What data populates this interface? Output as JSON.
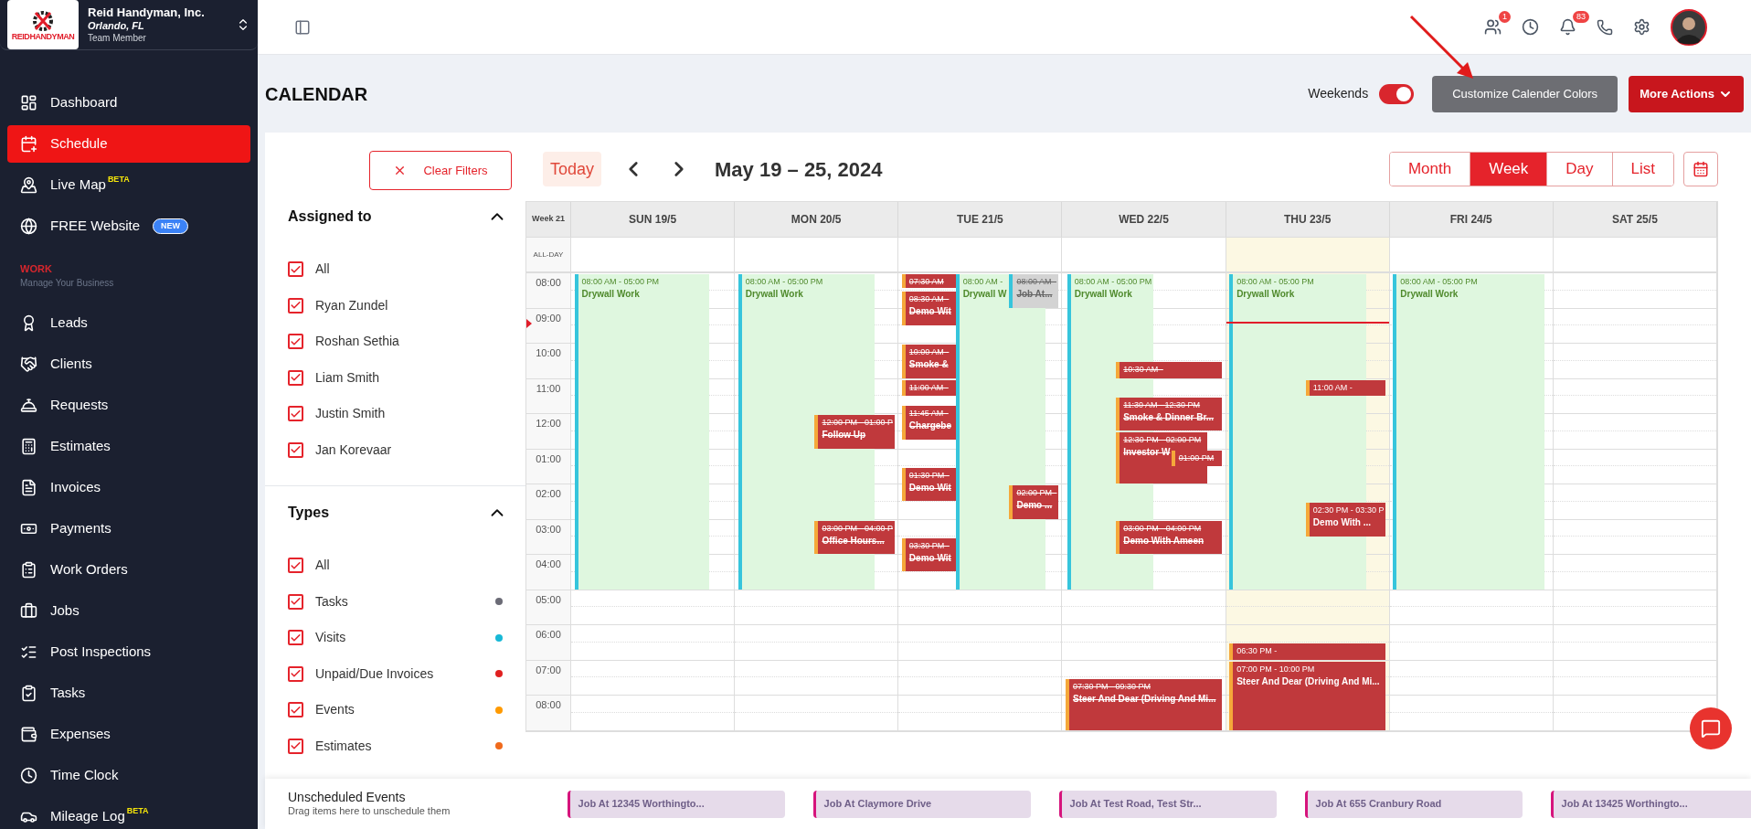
{
  "sidebar": {
    "account": {
      "logo_text": "REIDHANDYMAN",
      "name": "Reid Handyman, Inc.",
      "location": "Orlando, FL",
      "role": "Team Member"
    },
    "items": [
      {
        "kind": "link",
        "label": "Dashboard",
        "selected": false
      },
      {
        "kind": "link",
        "label": "Schedule",
        "selected": true
      },
      {
        "kind": "link",
        "label": "Live Map",
        "selected": false,
        "sup_label": "BETA"
      },
      {
        "kind": "link",
        "label": "FREE Website",
        "selected": false,
        "tag": "NEW"
      },
      {
        "kind": "section",
        "title": "WORK",
        "subtitle": "Manage Your Business"
      },
      {
        "kind": "link",
        "label": "Leads",
        "selected": false
      },
      {
        "kind": "link",
        "label": "Clients",
        "selected": false
      },
      {
        "kind": "link",
        "label": "Requests",
        "selected": false
      },
      {
        "kind": "link",
        "label": "Estimates",
        "selected": false
      },
      {
        "kind": "link",
        "label": "Invoices",
        "selected": false
      },
      {
        "kind": "link",
        "label": "Payments",
        "selected": false
      },
      {
        "kind": "link",
        "label": "Work Orders",
        "selected": false
      },
      {
        "kind": "link",
        "label": "Jobs",
        "selected": false
      },
      {
        "kind": "link",
        "label": "Post Inspections",
        "selected": false
      },
      {
        "kind": "link",
        "label": "Tasks",
        "selected": false
      },
      {
        "kind": "link",
        "label": "Expenses",
        "selected": false
      },
      {
        "kind": "link",
        "label": "Time Clock",
        "selected": false
      },
      {
        "kind": "link",
        "label": "Mileage Log",
        "selected": false,
        "sup_label": "BETA"
      }
    ]
  },
  "topbar": {
    "team_badge": "1",
    "notification_badge": "83"
  },
  "page": {
    "title": "CALENDAR",
    "weekends": {
      "label": "Weekends",
      "on": true
    },
    "buttons": [
      {
        "label": "Customize Calender Colors",
        "kind": "secondary"
      },
      {
        "label": "More Actions",
        "kind": "menu"
      }
    ]
  },
  "filters": {
    "clear_label": "Clear Filters",
    "groups": [
      {
        "title": "Assigned to",
        "expanded": true,
        "options": [
          {
            "label": "All",
            "checked": true
          },
          {
            "label": "Ryan Zundel",
            "checked": true
          },
          {
            "label": "Roshan Sethia",
            "checked": true
          },
          {
            "label": "Liam Smith",
            "checked": true
          },
          {
            "label": "Justin Smith",
            "checked": true
          },
          {
            "label": "Jan Korevaar",
            "checked": true
          }
        ]
      },
      {
        "title": "Types",
        "expanded": true,
        "options": [
          {
            "label": "All",
            "checked": true
          },
          {
            "label": "Tasks",
            "checked": true,
            "color": "#6b6b76"
          },
          {
            "label": "Visits",
            "checked": true,
            "color": "#17b8d6"
          },
          {
            "label": "Unpaid/Due Invoices",
            "checked": true,
            "color": "#e02020"
          },
          {
            "label": "Events",
            "checked": true,
            "color": "#ff9a00"
          },
          {
            "label": "Estimates",
            "checked": true,
            "color": "#f06a1c"
          }
        ]
      }
    ]
  },
  "calendar": {
    "today_label": "Today",
    "range": "May 19 – 25, 2024",
    "views": [
      {
        "label": "Month",
        "selected": false
      },
      {
        "label": "Week",
        "selected": true
      },
      {
        "label": "Day",
        "selected": false
      },
      {
        "label": "List",
        "selected": false
      }
    ],
    "week_label": "Week 21",
    "allday_label": "ALL-DAY",
    "days": [
      {
        "label": "SUN 19/5",
        "today": false
      },
      {
        "label": "MON 20/5",
        "today": false
      },
      {
        "label": "TUE 21/5",
        "today": false
      },
      {
        "label": "WED 22/5",
        "today": false
      },
      {
        "label": "THU 23/5",
        "today": true
      },
      {
        "label": "FRI 24/5",
        "today": false
      },
      {
        "label": "SAT 25/5",
        "today": false
      }
    ],
    "hours": [
      "08:00",
      "09:00",
      "10:00",
      "11:00",
      "12:00",
      "01:00",
      "02:00",
      "03:00",
      "04:00",
      "05:00",
      "06:00",
      "07:00",
      "08:00"
    ],
    "events": [
      {
        "kind": "work",
        "time": "08:00 AM - 05:00 PM",
        "title": "Drywall Work",
        "struck": false
      },
      {
        "kind": "work",
        "time": "08:00 AM - 05:00 PM",
        "title": "Drywall Work",
        "struck": false
      },
      {
        "kind": "event",
        "time": "12:00 PM - 01:00 P",
        "title": "Follow Up",
        "struck": true
      },
      {
        "kind": "event",
        "time": "03:00 PM - 04:00 P",
        "title": "Office Hours...",
        "struck": true
      },
      {
        "kind": "event",
        "time": "07:30 AM",
        "struck": true
      },
      {
        "kind": "event",
        "time": "08:30 AM -",
        "title": "Demo Wit",
        "struck": true
      },
      {
        "kind": "event",
        "time": "10:00 AM -",
        "title": "Smoke &",
        "struck": true
      },
      {
        "kind": "event",
        "time": "11:00 AM -",
        "struck": true
      },
      {
        "kind": "event",
        "time": "11:45 AM -",
        "title": "Chargebe",
        "struck": true
      },
      {
        "kind": "event",
        "time": "01:30 PM -",
        "title": "Demo Wit",
        "struck": true
      },
      {
        "kind": "event",
        "time": "03:30 PM -",
        "title": "Demo Wit",
        "struck": true
      },
      {
        "kind": "work",
        "time": "08:00 AM -",
        "title": "Drywall W",
        "struck": false
      },
      {
        "kind": "job",
        "time": "08:00 AM -",
        "title": "Job At...",
        "struck": true
      },
      {
        "kind": "event",
        "time": "02:00 PM -",
        "title": "Demo ...",
        "struck": true
      },
      {
        "kind": "work",
        "time": "08:00 AM - 05:00 PM",
        "title": "Drywall Work",
        "struck": false
      },
      {
        "kind": "event",
        "time": "10:30 AM -",
        "struck": true
      },
      {
        "kind": "event",
        "time": "11:30 AM - 12:30 PM",
        "title": "Smoke & Dinner Br...",
        "struck": true
      },
      {
        "kind": "event",
        "time": "12:30 PM - 02:00 PM",
        "title": "Investor W",
        "struck": true
      },
      {
        "kind": "event",
        "time": "01:00 PM",
        "struck": true
      },
      {
        "kind": "event",
        "time": "03:00 PM - 04:00 PM",
        "title": "Demo With Ameen",
        "struck": true
      },
      {
        "kind": "event",
        "time": "07:30 PM - 09:30 PM",
        "title": "Steer And Dear (Driving And Mi...",
        "struck": true
      },
      {
        "kind": "work",
        "time": "08:00 AM - 05:00 PM",
        "title": "Drywall Work",
        "struck": false
      },
      {
        "kind": "event",
        "time": "11:00 AM -",
        "struck": false
      },
      {
        "kind": "event",
        "time": "02:30 PM - 03:30 P",
        "title": "Demo With ...",
        "struck": false
      },
      {
        "kind": "event",
        "time": "06:30 PM -",
        "struck": false
      },
      {
        "kind": "event",
        "time": "07:00 PM - 10:00 PM",
        "title": "Steer And Dear (Driving And Mi...",
        "struck": false
      },
      {
        "kind": "work",
        "time": "08:00 AM - 05:00 PM",
        "title": "Drywall Work",
        "struck": false
      }
    ]
  },
  "unscheduled": {
    "title": "Unscheduled Events",
    "hint": "Drag items here to unschedule them",
    "items": [
      "Job At 12345 Worthingto...",
      "Job At Claymore Drive",
      "Job At Test Road, Test Str...",
      "Job At 655 Cranbury Road",
      "Job At 13425 Worthingto..."
    ]
  }
}
